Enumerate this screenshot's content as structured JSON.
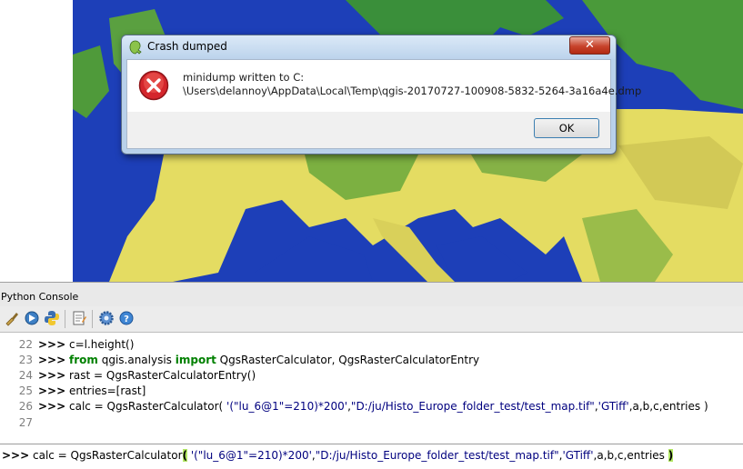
{
  "dialog": {
    "title": "Crash dumped",
    "message_line1": "minidump written to C:",
    "message_line2": "\\Users\\delannoy\\AppData\\Local\\Temp\\qgis-20170727-100908-5832-5264-3a16a4e.dmp",
    "ok_label": "OK",
    "close_label": "✕"
  },
  "console": {
    "title": "Python Console",
    "toolbar_icons": [
      "clear-console-icon",
      "run-command-icon",
      "python-icon",
      "show-editor-icon",
      "settings-icon",
      "help-icon"
    ],
    "history": [
      {
        "num": "22",
        "prompt": ">>>",
        "code": " c=l.height()"
      },
      {
        "num": "23",
        "prompt": ">>>",
        "kw1": "from",
        "mid": " qgis.analysis ",
        "kw2": "import",
        "rest": " QgsRasterCalculator, QgsRasterCalculatorEntry"
      },
      {
        "num": "24",
        "prompt": ">>>",
        "code": " rast = QgsRasterCalculatorEntry()"
      },
      {
        "num": "25",
        "prompt": ">>>",
        "code": " entries=[rast]"
      },
      {
        "num": "26",
        "prompt": ">>>",
        "pre": " calc = QgsRasterCalculator( ",
        "str1": "'(\"lu_6@1\"=210)*200'",
        "c1": ",",
        "str2": "\"D:/ju/Histo_Europe_folder_test/test_map.tif\"",
        "c2": ",",
        "str3": "'GTiff'",
        "post": ",a,b,c,entries )"
      },
      {
        "num": "27"
      }
    ],
    "input": {
      "prompt": ">>>",
      "pre": " calc = QgsRasterCalculator",
      "open": "(",
      "str1": " '(\"lu_6@1\"=210)*200'",
      "c1": ",",
      "str2": "\"D:/ju/Histo_Europe_folder_test/test_map.tif\"",
      "c2": ",",
      "str3": "'GTiff'",
      "post": ",a,b,c,entries ",
      "close": ")"
    }
  },
  "colors": {
    "sea": "#1d3fb8",
    "land_yellow": "#e8e066",
    "land_green": "#2f8f2f"
  }
}
